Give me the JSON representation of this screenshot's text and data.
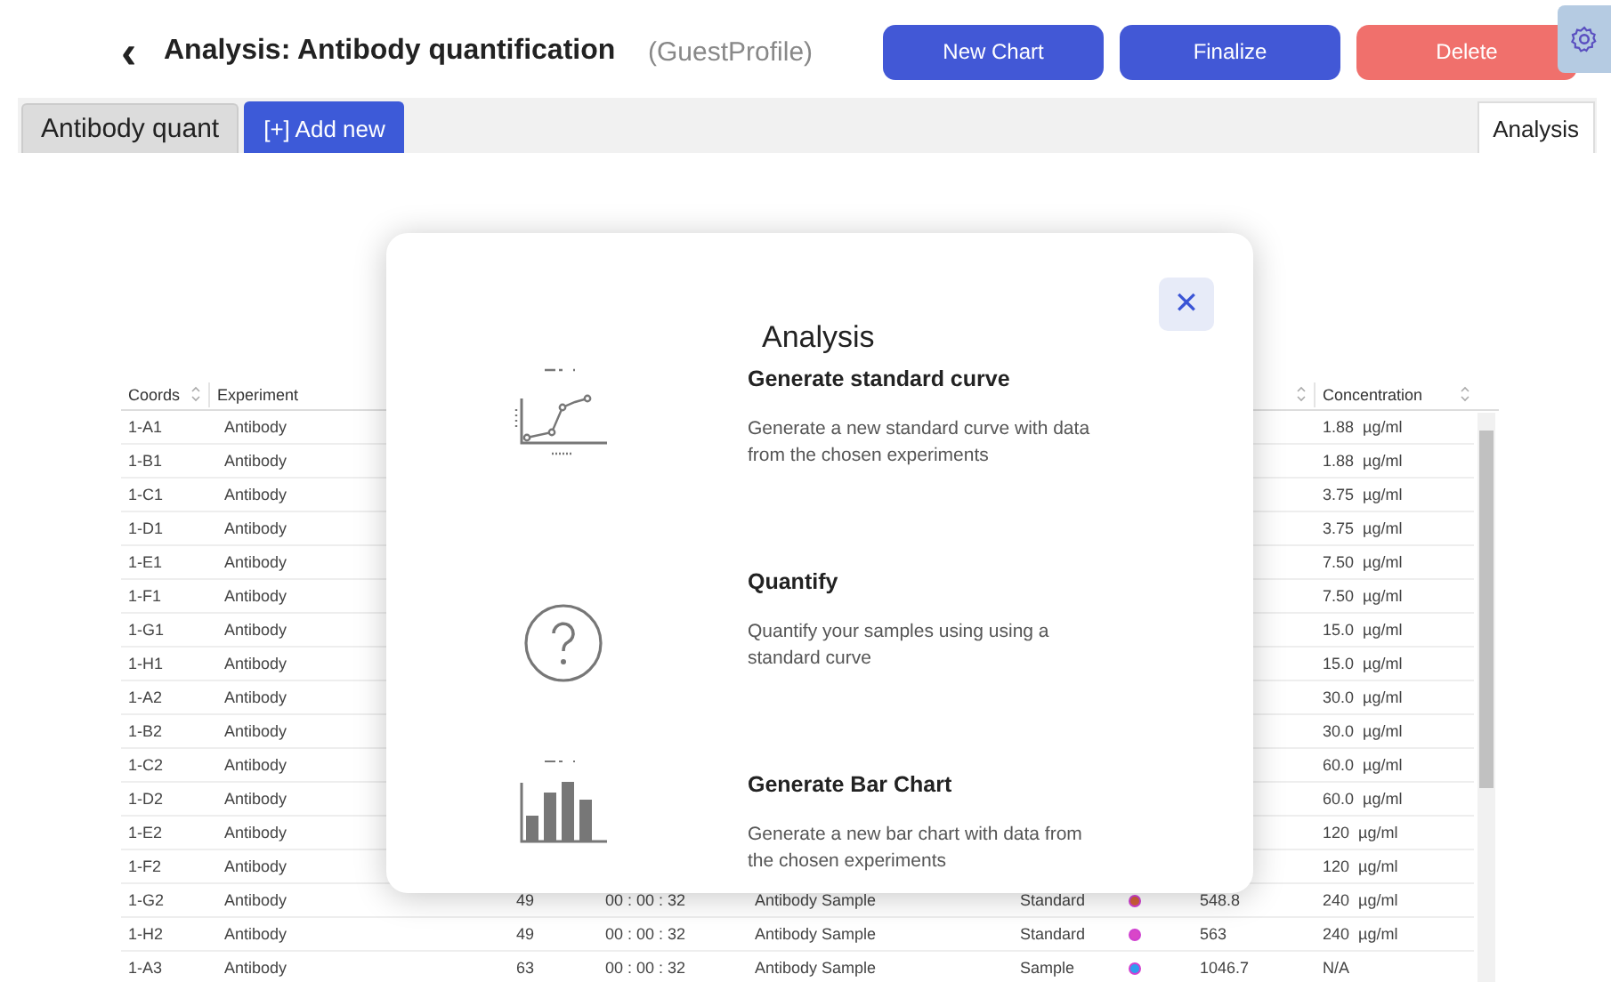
{
  "header": {
    "back_icon": "‹",
    "title": "Analysis: Antibody quantification",
    "profile": "(GuestProfile)",
    "buttons": [
      {
        "label": "New Chart",
        "kind": "primary"
      },
      {
        "label": "Finalize",
        "kind": "primary"
      },
      {
        "label": "Delete",
        "kind": "danger"
      }
    ]
  },
  "tabs": [
    {
      "label": "Antibody quant",
      "kind": "tab",
      "selected": false
    },
    {
      "label": "[+] Add new",
      "kind": "add",
      "selected": false
    }
  ],
  "right_tab": {
    "label": "Analysis",
    "selected": true
  },
  "table": {
    "columns": [
      {
        "label": "Coords"
      },
      {
        "label": "Experiment"
      },
      {
        "label": "Concentration"
      }
    ],
    "rows": [
      {
        "coords": "1-A1",
        "experiment": "Antibody",
        "concentration": "1.88  µg/ml"
      },
      {
        "coords": "1-B1",
        "experiment": "Antibody",
        "concentration": "1.88  µg/ml"
      },
      {
        "coords": "1-C1",
        "experiment": "Antibody",
        "concentration": "3.75  µg/ml"
      },
      {
        "coords": "1-D1",
        "experiment": "Antibody",
        "concentration": "3.75  µg/ml"
      },
      {
        "coords": "1-E1",
        "experiment": "Antibody",
        "concentration": "7.50  µg/ml"
      },
      {
        "coords": "1-F1",
        "experiment": "Antibody",
        "concentration": "7.50  µg/ml"
      },
      {
        "coords": "1-G1",
        "experiment": "Antibody",
        "concentration": "15.0  µg/ml"
      },
      {
        "coords": "1-H1",
        "experiment": "Antibody",
        "concentration": "15.0  µg/ml"
      },
      {
        "coords": "1-A2",
        "experiment": "Antibody",
        "concentration": "30.0  µg/ml"
      },
      {
        "coords": "1-B2",
        "experiment": "Antibody",
        "concentration": "30.0  µg/ml"
      },
      {
        "coords": "1-C2",
        "experiment": "Antibody",
        "concentration": "60.0  µg/ml"
      },
      {
        "coords": "1-D2",
        "experiment": "Antibody",
        "concentration": "60.0  µg/ml"
      },
      {
        "coords": "1-E2",
        "experiment": "Antibody",
        "concentration": "120  µg/ml"
      },
      {
        "coords": "1-F2",
        "experiment": "Antibody",
        "concentration": "120  µg/ml"
      },
      {
        "coords": "1-G2",
        "experiment": "Antibody",
        "column_3": "49",
        "column_4": "00 : 00 : 32",
        "column_5": "Antibody Sample",
        "column_6": "Standard",
        "color": "#d2603a",
        "column_8": "548.8",
        "concentration": "240  µg/ml"
      },
      {
        "coords": "1-H2",
        "experiment": "Antibody",
        "column_3": "49",
        "column_4": "00 : 00 : 32",
        "column_5": "Antibody Sample",
        "column_6": "Standard",
        "color": "#d946c8",
        "column_8": "563",
        "concentration": "240  µg/ml"
      },
      {
        "coords": "1-A3",
        "experiment": "Antibody",
        "column_3": "63",
        "column_4": "00 : 00 : 32",
        "column_5": "Antibody Sample",
        "column_6": "Sample",
        "color": "#2e9cf0",
        "column_8": "1046.7",
        "concentration": "N/A"
      }
    ]
  },
  "modal": {
    "title": "Analysis",
    "close": "✕",
    "options": [
      {
        "kind": "curve",
        "title": "Generate standard curve",
        "description": "Generate a new standard curve with data from the chosen experiments"
      },
      {
        "kind": "question",
        "title": "Quantify",
        "description": "Quantify your samples using using a standard curve"
      },
      {
        "kind": "bars",
        "title": "Generate Bar Chart",
        "description": "Generate a new bar chart with data from the chosen experiments"
      }
    ]
  }
}
